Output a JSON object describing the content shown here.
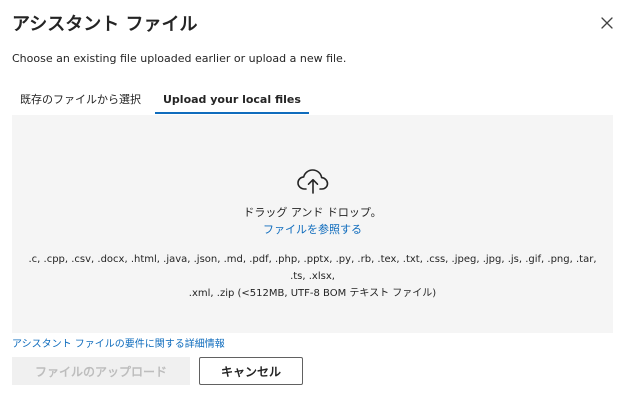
{
  "dialog": {
    "title": "アシスタント ファイル",
    "subtitle": "Choose an existing file uploaded earlier or upload a new file."
  },
  "tabs": [
    {
      "label": "既存のファイルから選択",
      "active": false
    },
    {
      "label": "Upload your local files",
      "active": true
    }
  ],
  "dropzone": {
    "icon": "cloud-upload-icon",
    "drag_text": "ドラッグ アンド ドロップ。",
    "browse_link": "ファイルを参照する",
    "formats_line1": ".c, .cpp, .csv, .docx, .html, .java, .json, .md, .pdf, .php, .pptx, .py, .rb, .tex, .txt, .css, .jpeg, .jpg, .js, .gif, .png, .tar, .ts, .xlsx,",
    "formats_line2": ".xml, .zip (<512MB, UTF-8 BOM テキスト ファイル)"
  },
  "requirements_link": "アシスタント ファイルの要件に関する詳細情報",
  "buttons": {
    "upload_label": "ファイルのアップロード",
    "cancel_label": "キャンセル"
  },
  "colors": {
    "accent": "#0f6cbd",
    "dropzone_bg": "#f5f5f5",
    "disabled_text": "#bdbdbd"
  }
}
